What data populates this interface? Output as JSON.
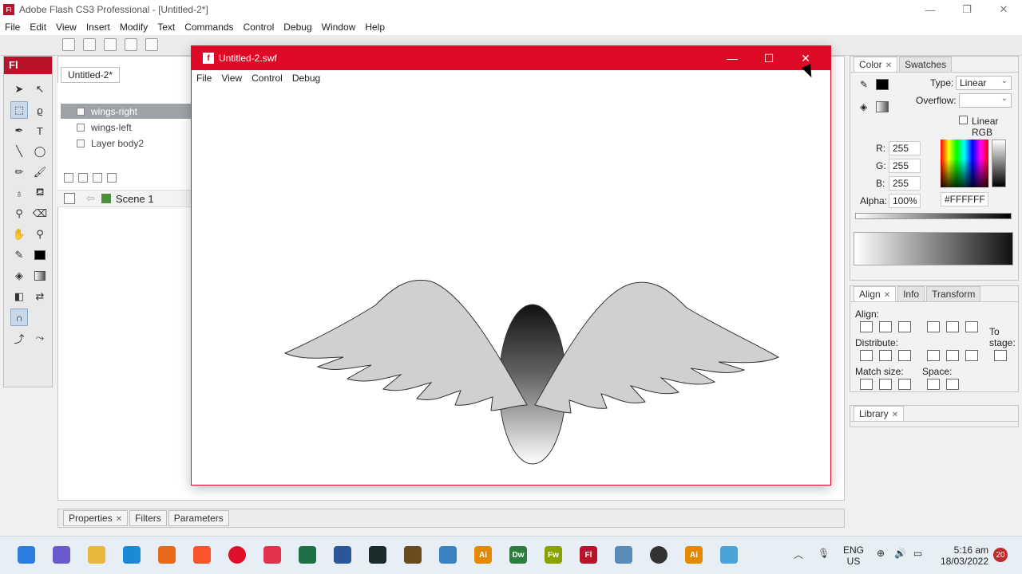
{
  "app": {
    "icon_text": "Fl",
    "title": "Adobe Flash CS3 Professional - [Untitled-2*]",
    "controls": {
      "minimize": "—",
      "restore": "❐",
      "close": "✕"
    }
  },
  "menu": [
    "File",
    "Edit",
    "View",
    "Insert",
    "Modify",
    "Text",
    "Commands",
    "Control",
    "Debug",
    "Window",
    "Help"
  ],
  "tools": {
    "logo": "Fl"
  },
  "document": {
    "tab": "Untitled-2*",
    "layers": [
      "wings-right",
      "wings-left",
      "Layer body2"
    ],
    "scene": "Scene 1"
  },
  "swf_window": {
    "title": "Untitled-2.swf",
    "icon_text": "f",
    "controls": {
      "minimize": "—",
      "maximize": "☐",
      "close": "✕"
    },
    "menu": [
      "File",
      "View",
      "Control",
      "Debug"
    ]
  },
  "color_panel": {
    "tabs": [
      "Color",
      "Swatches"
    ],
    "type_label": "Type:",
    "type_value": "Linear",
    "overflow_label": "Overflow:",
    "linear_rgb": "Linear RGB",
    "r_label": "R:",
    "r_value": "255",
    "g_label": "G:",
    "g_value": "255",
    "b_label": "B:",
    "b_value": "255",
    "alpha_label": "Alpha:",
    "alpha_value": "100%",
    "hex_value": "#FFFFFF"
  },
  "align_panel": {
    "tabs": [
      "Align",
      "Info",
      "Transform"
    ],
    "align_label": "Align:",
    "distribute_label": "Distribute:",
    "match_size_label": "Match size:",
    "space_label": "Space:",
    "to_stage_label": "To stage:"
  },
  "library_panel": {
    "tab": "Library"
  },
  "properties_bar": {
    "tabs": [
      "Properties",
      "Filters",
      "Parameters"
    ]
  },
  "taskbar": {
    "apps": [
      "Ai",
      "Dw",
      "Fw",
      "Fl",
      "Ai"
    ],
    "language_line1": "ENG",
    "language_line2": "US",
    "time": "5:16 am",
    "date": "18/03/2022",
    "notifications": "20"
  }
}
